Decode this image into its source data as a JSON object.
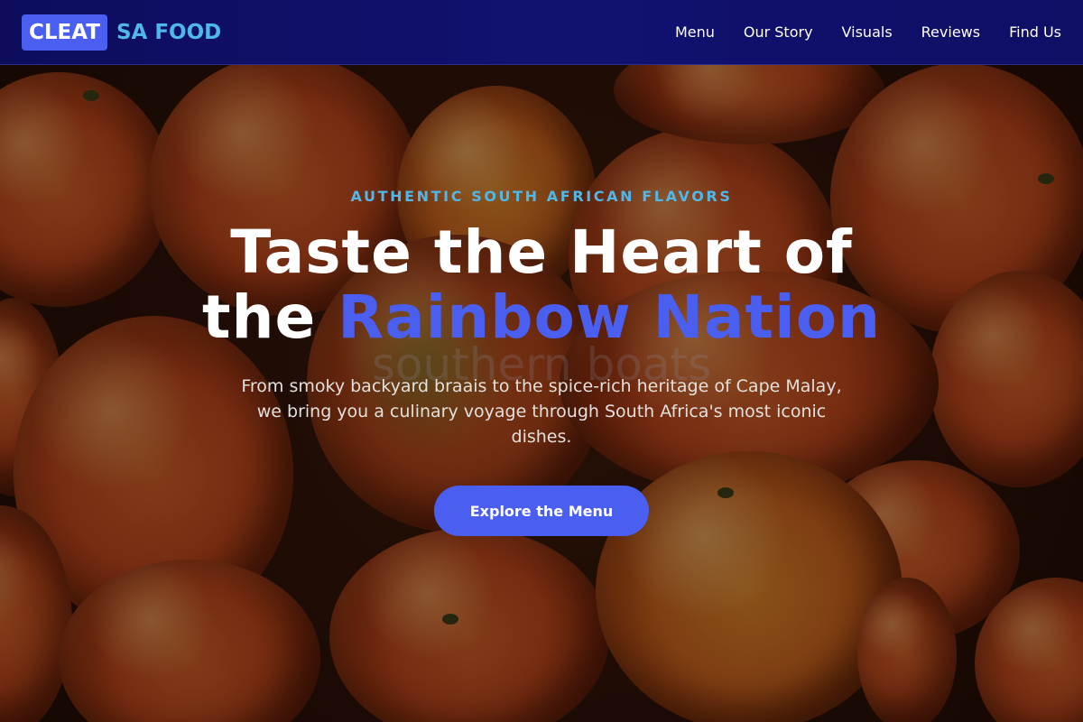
{
  "nav": {
    "brand_badge": "CLEAT",
    "brand_text": "SA FOOD",
    "links": [
      {
        "label": "Menu"
      },
      {
        "label": "Our Story"
      },
      {
        "label": "Visuals"
      },
      {
        "label": "Reviews"
      },
      {
        "label": "Find Us"
      }
    ]
  },
  "hero": {
    "eyebrow": "AUTHENTIC SOUTH AFRICAN FLAVORS",
    "headline_line1": "Taste the Heart of",
    "headline_line2_prefix": "the ",
    "headline_line2_accent": "Rainbow Nation",
    "ghost_text": "southern boats",
    "subtitle": "From smoky backyard braais to the spice-rich heritage of Cape Malay, we bring you a culinary voyage through South Africa's most iconic dishes.",
    "cta_label": "Explore the Menu",
    "background": "mandarin oranges photo"
  },
  "colors": {
    "nav_bg": "#0f0f66",
    "accent_blue": "#4a5ef0",
    "accent_cyan": "#4fb7ea",
    "text_white": "#ffffff"
  }
}
